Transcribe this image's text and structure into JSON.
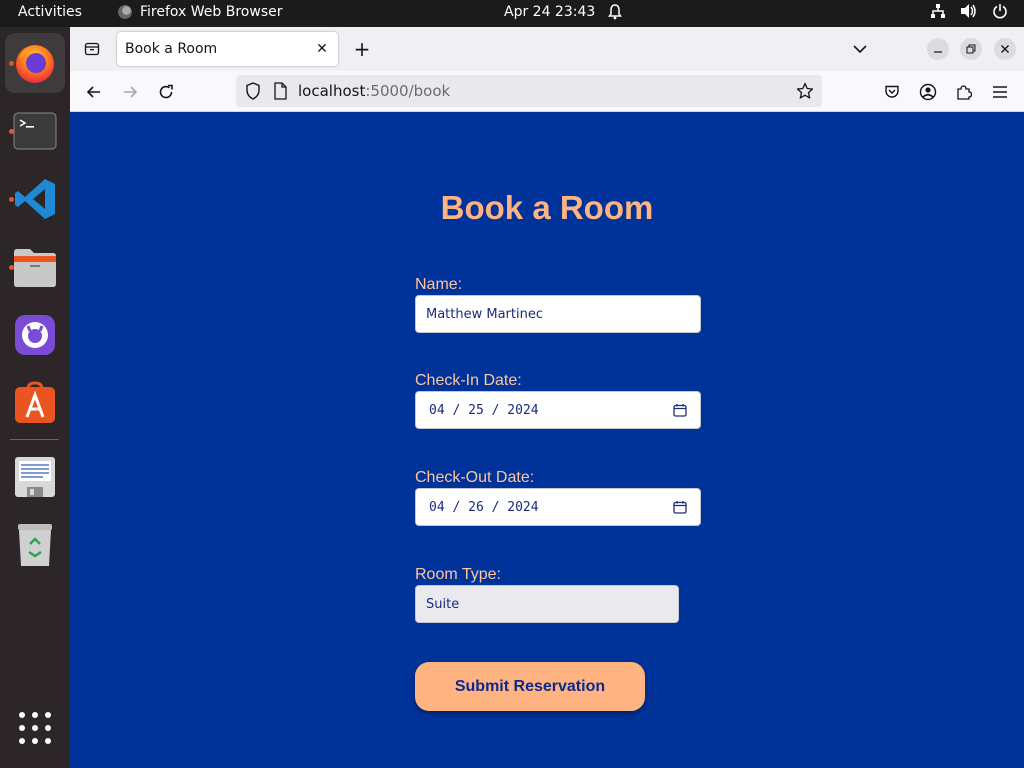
{
  "top_bar": {
    "activities": "Activities",
    "app_name": "Firefox Web Browser",
    "clock": "Apr 24  23:43"
  },
  "dock": {
    "items": [
      "firefox",
      "terminal",
      "vscode",
      "files",
      "github-desktop",
      "app-center",
      "text-editor",
      "trash"
    ]
  },
  "browser": {
    "tab_title": "Book a Room",
    "url_host": "localhost",
    "url_path": ":5000/book"
  },
  "form": {
    "title": "Book a Room",
    "name_label": "Name:",
    "name_value": "Matthew Martinec",
    "checkin_label": "Check-In Date:",
    "checkin_value": "04 / 25 / 2024",
    "checkout_label": "Check-Out Date:",
    "checkout_value": "04 / 26 / 2024",
    "room_label": "Room Type:",
    "room_value": "Suite",
    "submit_label": "Submit Reservation"
  },
  "colors": {
    "page_bg": "#003399",
    "accent": "#ffb380"
  }
}
